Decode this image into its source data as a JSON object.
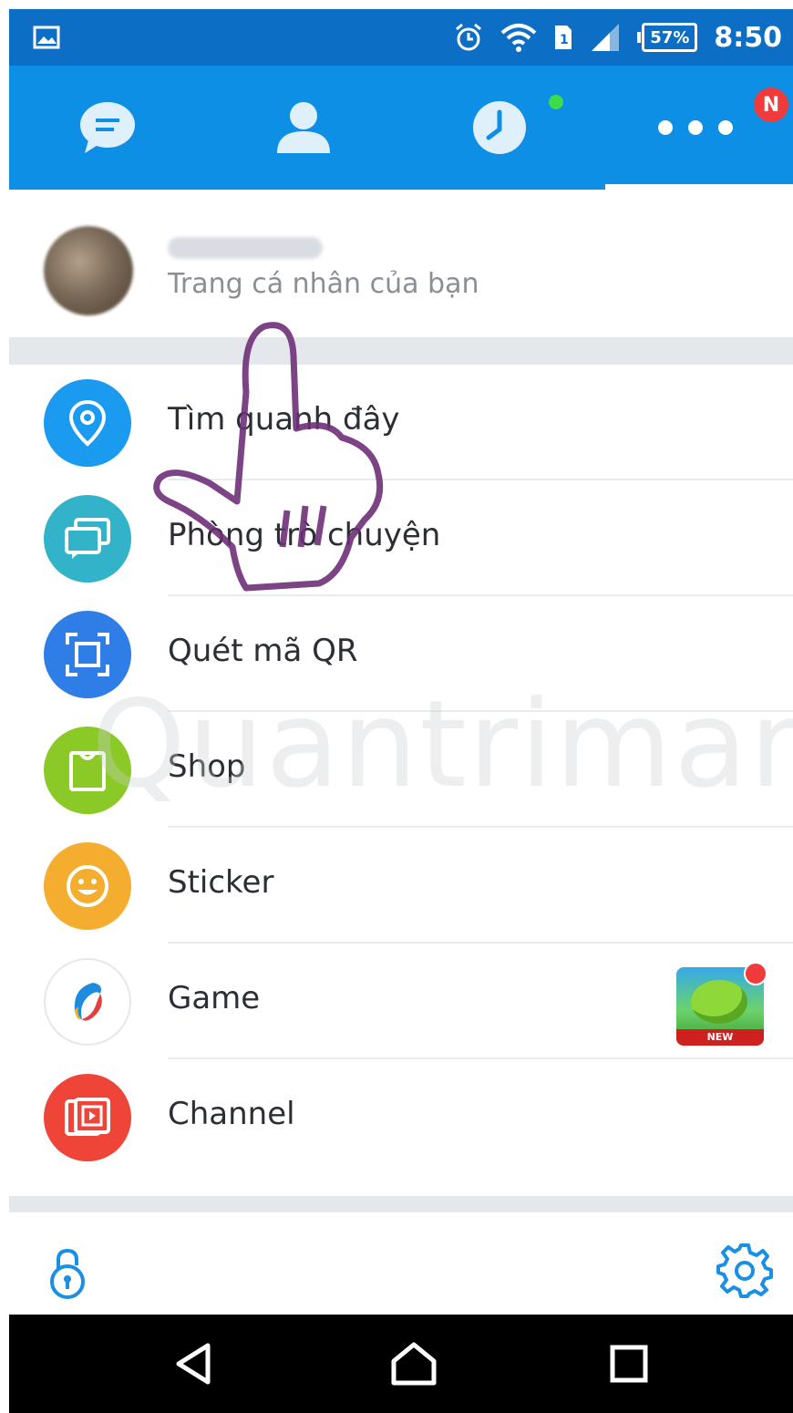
{
  "status_bar": {
    "battery": "57%",
    "time": "8:50",
    "icons": [
      "image-icon",
      "alarm-icon",
      "wifi-icon",
      "sim-icon",
      "signal-icon",
      "battery-icon"
    ]
  },
  "tabs": {
    "items": [
      {
        "name": "messages",
        "icon": "chat-bubble-icon"
      },
      {
        "name": "contacts",
        "icon": "person-icon"
      },
      {
        "name": "timeline",
        "icon": "clock-icon"
      },
      {
        "name": "more",
        "icon": "more-dots-icon",
        "badge": "N"
      }
    ],
    "active_index": 3,
    "accent": "#0d8fe6"
  },
  "profile": {
    "subtitle": "Trang cá nhân của bạn"
  },
  "menu": {
    "items": [
      {
        "label": "Tìm quanh đây",
        "icon": "location-pin-icon",
        "color": "#1a9bef"
      },
      {
        "label": "Phòng trò chuyện",
        "icon": "chat-rooms-icon",
        "color": "#33b3c9"
      },
      {
        "label": "Quét mã QR",
        "icon": "qr-scan-icon",
        "color": "#2f7ee8"
      },
      {
        "label": "Shop",
        "icon": "shopping-bag-icon",
        "color": "#8ac926"
      },
      {
        "label": "Sticker",
        "icon": "smiley-icon",
        "color": "#f4ad2e"
      },
      {
        "label": "Game",
        "icon": "game-logo-icon",
        "color": "#ffffff"
      },
      {
        "label": "Channel",
        "icon": "video-channel-icon",
        "color": "#ef4438"
      }
    ],
    "game_badge_label": "NEW"
  },
  "footer": {
    "icons": [
      "lock-icon",
      "settings-gear-icon"
    ]
  },
  "watermark": "Quantrimang",
  "nav_bar": {
    "icons": [
      "back-icon",
      "home-icon",
      "recents-icon"
    ]
  }
}
